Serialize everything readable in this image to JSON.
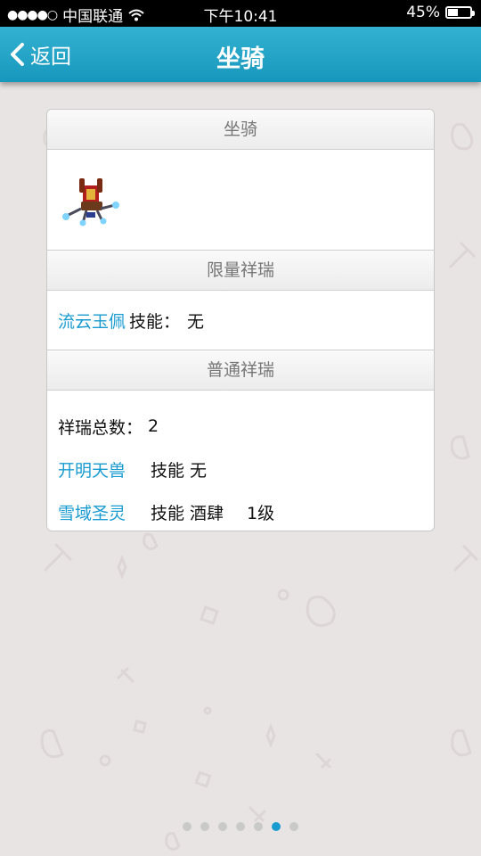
{
  "status_bar": {
    "signal_dots": "●●●●○",
    "carrier": "中国联通",
    "time": "下午10:41",
    "battery_text": "45%",
    "battery_level": 0.45
  },
  "nav": {
    "back_label": "返回",
    "title": "坐骑"
  },
  "card": {
    "mount_header": "坐骑",
    "limited_header": "限量祥瑞",
    "limited_item": {
      "name": "流云玉佩",
      "skill_label": "技能：",
      "skill_value": "无"
    },
    "normal_header": "普通祥瑞",
    "normal_total_label": "祥瑞总数：",
    "normal_total_value": "2",
    "normal_items": [
      {
        "name": "开明天兽",
        "skill_label": "技能",
        "skill_value": "无",
        "level": ""
      },
      {
        "name": "雪域圣灵",
        "skill_label": "技能",
        "skill_value": "酒肆",
        "level": "1级"
      }
    ]
  },
  "page_indicator": {
    "count": 7,
    "active_index": 5
  },
  "colors": {
    "nav_bar": "#1fa2c8",
    "link": "#1a9bd0",
    "background": "#e9e4e4"
  }
}
